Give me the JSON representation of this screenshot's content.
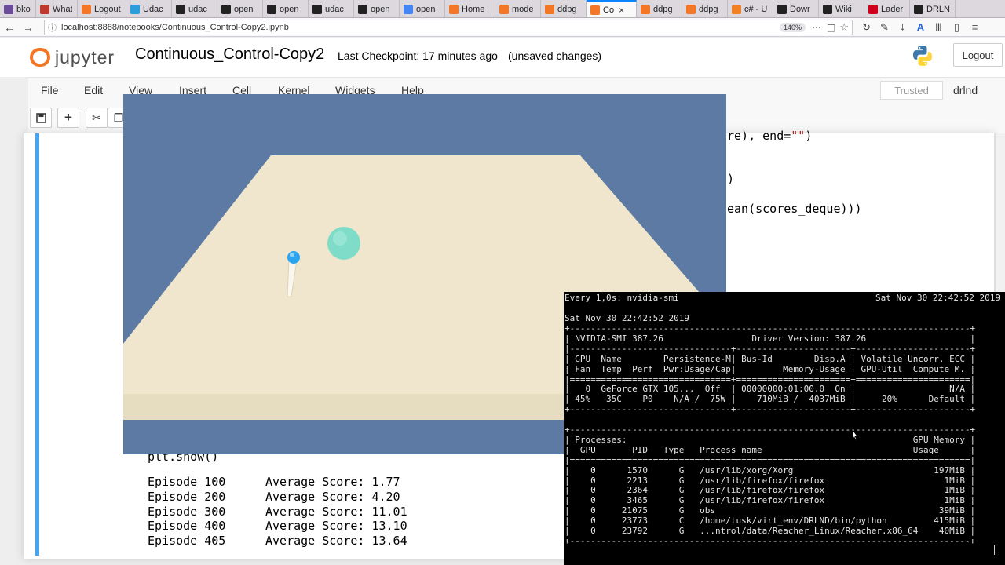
{
  "browser": {
    "tabs": [
      {
        "label": "bkoco",
        "color": "#6b4c9a"
      },
      {
        "label": "What",
        "color": "#c0392b"
      },
      {
        "label": "Logout · s",
        "color": "#f37726"
      },
      {
        "label": "Udac",
        "color": "#2d9cdb"
      },
      {
        "label": "udac",
        "color": "#222222"
      },
      {
        "label": "open",
        "color": "#222222"
      },
      {
        "label": "open",
        "color": "#222222"
      },
      {
        "label": "udac",
        "color": "#222222"
      },
      {
        "label": "open",
        "color": "#222222"
      },
      {
        "label": "open",
        "color": "#4285f4"
      },
      {
        "label": "Home",
        "color": "#f37726"
      },
      {
        "label": "mode",
        "color": "#f37726"
      },
      {
        "label": "ddpg",
        "color": "#f37726"
      },
      {
        "label": "Co",
        "color": "#f37726",
        "active": true
      },
      {
        "label": "ddpg",
        "color": "#f37726"
      },
      {
        "label": "ddpg",
        "color": "#f37726"
      },
      {
        "label": "c# - U",
        "color": "#f48024"
      },
      {
        "label": "Dowr",
        "color": "#222222"
      },
      {
        "label": "Wiki",
        "color": "#222222"
      },
      {
        "label": "Lader",
        "color": "#d0021b"
      },
      {
        "label": "DRLN",
        "color": "#222222"
      }
    ],
    "url": "localhost:8888/notebooks/Continuous_Control-Copy2.ipynb",
    "zoom": "140%",
    "more_icon": "⋯"
  },
  "header": {
    "logo_text": "jupyter",
    "notebook_title": "Continuous_Control-Copy2",
    "checkpoint": "Last Checkpoint: 17 minutes ago",
    "unsaved": "(unsaved changes)",
    "logout_label": "Logout"
  },
  "menu": {
    "items": [
      "File",
      "Edit",
      "View",
      "Insert",
      "Cell",
      "Kernel",
      "Widgets",
      "Help"
    ],
    "trusted": "Trusted",
    "kernel_name": "drlnd"
  },
  "code": {
    "line1_a": "re), end=",
    "line1_b": "\"\"",
    "line1_c": ")",
    "line2": ")",
    "line3": "ean(scores_deque)))",
    "line4": "plt.show()"
  },
  "output": {
    "rows": [
      {
        "episode": "Episode 100",
        "score": "Average Score: 1.77"
      },
      {
        "episode": "Episode 200",
        "score": "Average Score: 4.20"
      },
      {
        "episode": "Episode 300",
        "score": "Average Score: 11.01"
      },
      {
        "episode": "Episode 400",
        "score": "Average Score: 13.10"
      },
      {
        "episode": "Episode 405",
        "score": "Average Score: 13.64"
      }
    ]
  },
  "terminal": {
    "header_left": "Every 1,0s: nvidia-smi",
    "header_right": "Sat Nov 30 22:42:52 2019",
    "date": "Sat Nov 30 22:42:52 2019",
    "lines": [
      "+-----------------------------------------------------------------------------+",
      "| NVIDIA-SMI 387.26                 Driver Version: 387.26                    |",
      "|-------------------------------+----------------------+----------------------+",
      "| GPU  Name        Persistence-M| Bus-Id        Disp.A | Volatile Uncorr. ECC |",
      "| Fan  Temp  Perf  Pwr:Usage/Cap|         Memory-Usage | GPU-Util  Compute M. |",
      "|===============================+======================+======================|",
      "|   0  GeForce GTX 105...  Off  | 00000000:01:00.0  On |                  N/A |",
      "| 45%   35C    P0    N/A /  75W |    710MiB /  4037MiB |     20%      Default |",
      "+-------------------------------+----------------------+----------------------+",
      "",
      "+-----------------------------------------------------------------------------+",
      "| Processes:                                                       GPU Memory |",
      "|  GPU       PID   Type   Process name                             Usage      |",
      "|=============================================================================|",
      "|    0      1570      G   /usr/lib/xorg/Xorg                           197MiB |",
      "|    0      2213      G   /usr/lib/firefox/firefox                       1MiB |",
      "|    0      2364      G   /usr/lib/firefox/firefox                       1MiB |",
      "|    0      3465      G   /usr/lib/firefox/firefox                       1MiB |",
      "|    0     21075      G   obs                                           39MiB |",
      "|    0     23773      C   /home/tusk/virt_env/DRLND/bin/python         415MiB |",
      "|    0     23792      G   ...ntrol/data/Reacher_Linux/Reacher.x86_64    40MiB |",
      "+-----------------------------------------------------------------------------+"
    ]
  },
  "colors": {
    "accent": "#42a5f5",
    "jupyter_orange": "#f37726",
    "game_sky": "#5d7aa4",
    "game_floor": "#efe6cd",
    "target_sphere": "#7fdcc8",
    "arm_tip": "#2aa5f0"
  }
}
